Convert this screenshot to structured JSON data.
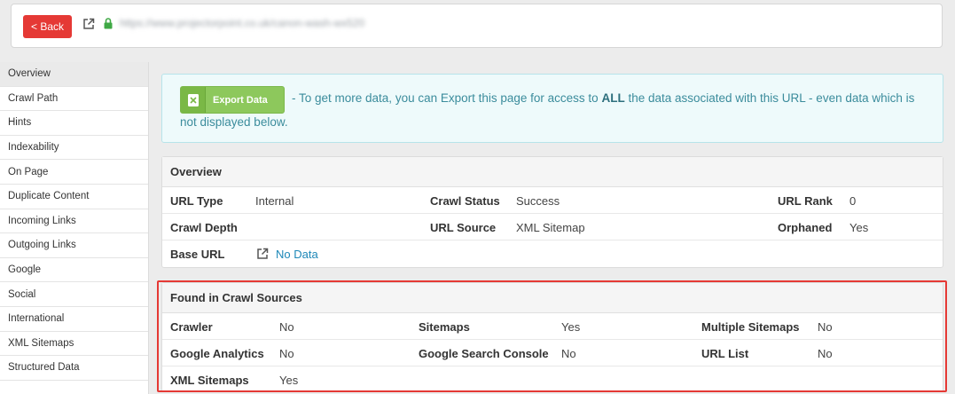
{
  "topbar": {
    "back_label": "< Back",
    "url": "https://www.projectorpoint.co.uk/canon-wash-wx520"
  },
  "sidebar": {
    "items": [
      {
        "label": "Overview",
        "active": true
      },
      {
        "label": "Crawl Path"
      },
      {
        "label": "Hints"
      },
      {
        "label": "Indexability"
      },
      {
        "label": "On Page"
      },
      {
        "label": "Duplicate Content"
      },
      {
        "label": "Incoming Links"
      },
      {
        "label": "Outgoing Links"
      },
      {
        "label": "Google"
      },
      {
        "label": "Social"
      },
      {
        "label": "International"
      },
      {
        "label": "XML Sitemaps"
      },
      {
        "label": "Structured Data"
      }
    ]
  },
  "notice": {
    "export_label": "Export Data",
    "text_part1": "- To get more data, you can Export this page for access to ",
    "text_bold": "ALL",
    "text_part2": " the data associated with this URL - even data which is",
    "text_line2": "not displayed below."
  },
  "overview": {
    "title": "Overview",
    "url_type_label": "URL Type",
    "url_type_value": "Internal",
    "crawl_status_label": "Crawl Status",
    "crawl_status_value": "Success",
    "url_rank_label": "URL Rank",
    "url_rank_value": "0",
    "crawl_depth_label": "Crawl Depth",
    "crawl_depth_value": "",
    "url_source_label": "URL Source",
    "url_source_value": "XML Sitemap",
    "orphaned_label": "Orphaned",
    "orphaned_value": "Yes",
    "base_url_label": "Base URL",
    "base_url_value": "No Data"
  },
  "crawl_sources": {
    "title": "Found in Crawl Sources",
    "crawler_label": "Crawler",
    "crawler_value": "No",
    "sitemaps_label": "Sitemaps",
    "sitemaps_value": "Yes",
    "multiple_sitemaps_label": "Multiple Sitemaps",
    "multiple_sitemaps_value": "No",
    "ga_label": "Google Analytics",
    "ga_value": "No",
    "gsc_label": "Google Search Console",
    "gsc_value": "No",
    "url_list_label": "URL List",
    "url_list_value": "No",
    "xml_sitemaps_label": "XML Sitemaps",
    "xml_sitemaps_value": "Yes"
  },
  "colors": {
    "back_button": "#e53935",
    "export_button": "#8dc85c",
    "notice_text": "#3b8c9c",
    "link": "#1e88b8",
    "highlight": "#e53935"
  }
}
